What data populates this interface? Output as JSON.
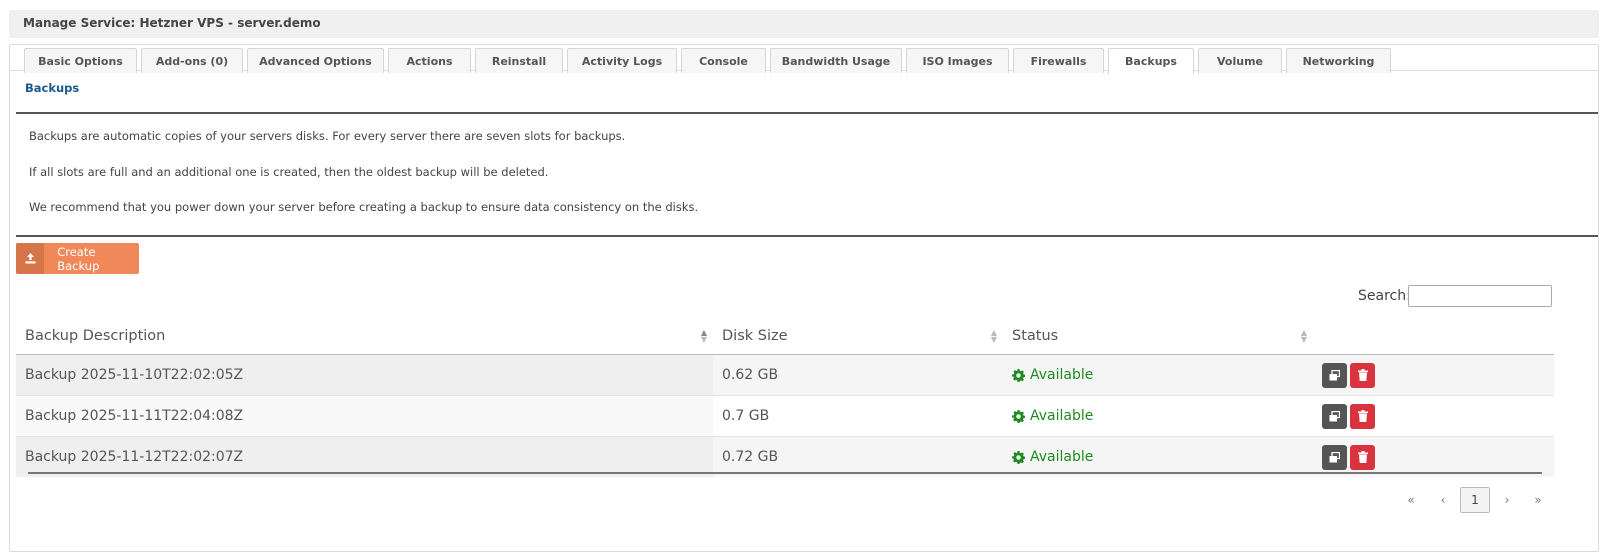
{
  "header": {
    "title": "Manage Service: Hetzner VPS - server.demo"
  },
  "tabs": [
    {
      "label": "Basic Options"
    },
    {
      "label": "Add-ons (0)"
    },
    {
      "label": "Advanced Options"
    },
    {
      "label": "Actions"
    },
    {
      "label": "Reinstall"
    },
    {
      "label": "Activity Logs"
    },
    {
      "label": "Console"
    },
    {
      "label": "Bandwidth Usage"
    },
    {
      "label": "ISO Images"
    },
    {
      "label": "Firewalls"
    },
    {
      "label": "Backups",
      "active": true
    },
    {
      "label": "Volume"
    },
    {
      "label": "Networking"
    }
  ],
  "section": {
    "title": "Backups",
    "description": [
      "Backups are automatic copies of your servers disks. For every server there are seven slots for backups.",
      "If all slots are full and an additional one is created, then the oldest backup will be deleted.",
      "We recommend that you power down your server before creating a backup to ensure data consistency on the disks."
    ]
  },
  "create_button": {
    "label": "Create Backup",
    "icon": "upload-icon"
  },
  "search": {
    "label": "Search:",
    "value": ""
  },
  "table": {
    "columns": [
      "Backup Description",
      "Disk Size",
      "Status"
    ],
    "rows": [
      {
        "description": "Backup 2025-11-10T22:02:05Z",
        "size": "0.62 GB",
        "status": "Available"
      },
      {
        "description": "Backup 2025-11-11T22:04:08Z",
        "size": "0.7 GB",
        "status": "Available"
      },
      {
        "description": "Backup 2025-11-12T22:02:07Z",
        "size": "0.72 GB",
        "status": "Available"
      }
    ]
  },
  "pagination": {
    "first": "«",
    "prev": "‹",
    "current": "1",
    "next": "›",
    "last": "»"
  },
  "colors": {
    "accent_orange": "#f0885a",
    "status_green": "#1f8a1f",
    "delete_red": "#d9333f",
    "link_blue": "#1a5a8f"
  }
}
